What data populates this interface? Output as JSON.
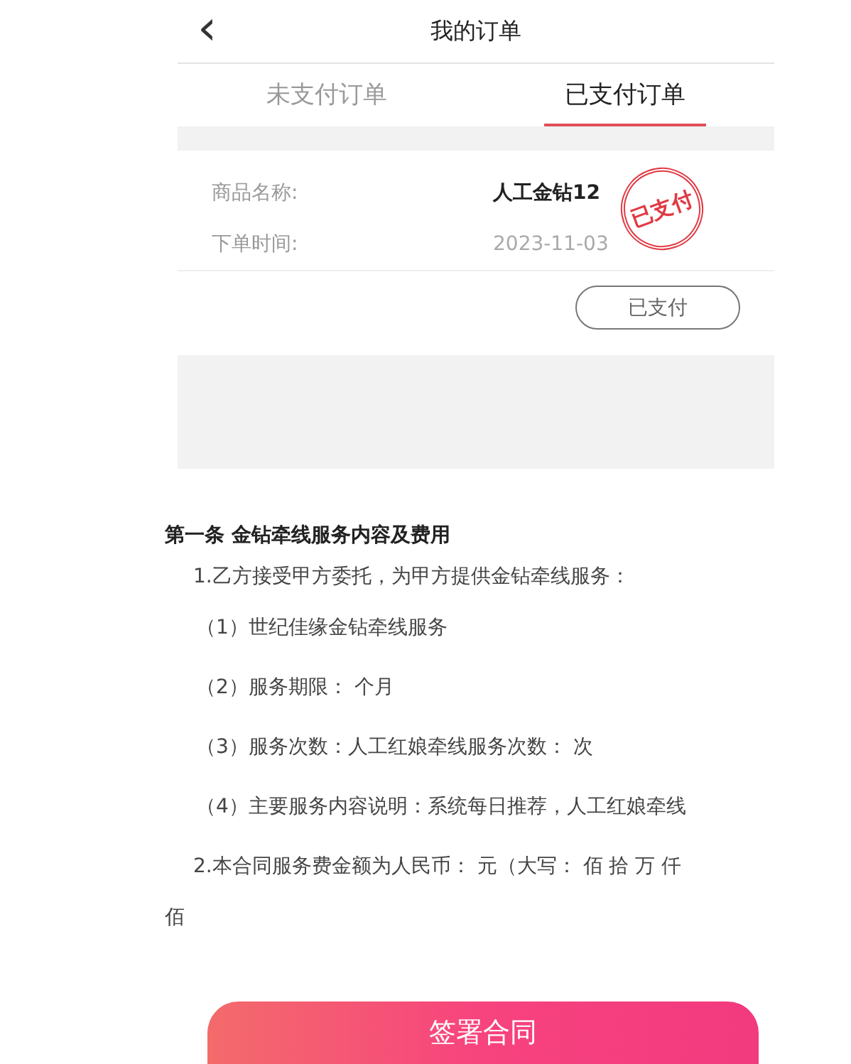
{
  "header": {
    "back_icon": "‹",
    "title": "我的订单"
  },
  "tabs": [
    {
      "label": "未支付订单",
      "selected": false
    },
    {
      "label": "已支付订单",
      "selected": true
    }
  ],
  "order": {
    "fields": [
      {
        "label": "商品名称:",
        "value": "人工金钻12",
        "kind": "bold"
      },
      {
        "label": "下单时间:",
        "value": "2023-11-03",
        "kind": "plain"
      }
    ],
    "stamp": "已支付",
    "status_button": "已支付"
  },
  "contract": {
    "heading": "第一条 金钻牵线服务内容及费用",
    "paragraphs": [
      {
        "text": "1.乙方接受甲方委托，为甲方提供金钻牵线服务：",
        "kind": "para"
      },
      {
        "text": "（1）世纪佳缘金钻牵线服务",
        "kind": "item"
      },
      {
        "text": "（2）服务期限：  个月",
        "kind": "item"
      },
      {
        "text": "（3）服务次数：人工红娘牵线服务次数：  次",
        "kind": "item"
      },
      {
        "text": "（4）主要服务内容说明：系统每日推荐，人工红娘牵线",
        "kind": "item"
      },
      {
        "text": "2.本合同服务费金额为人民币：  元（大写：  佰 拾 万 仟",
        "kind": "para"
      },
      {
        "text": "佰",
        "kind": "para"
      }
    ]
  },
  "sign_button": "签署合同"
}
